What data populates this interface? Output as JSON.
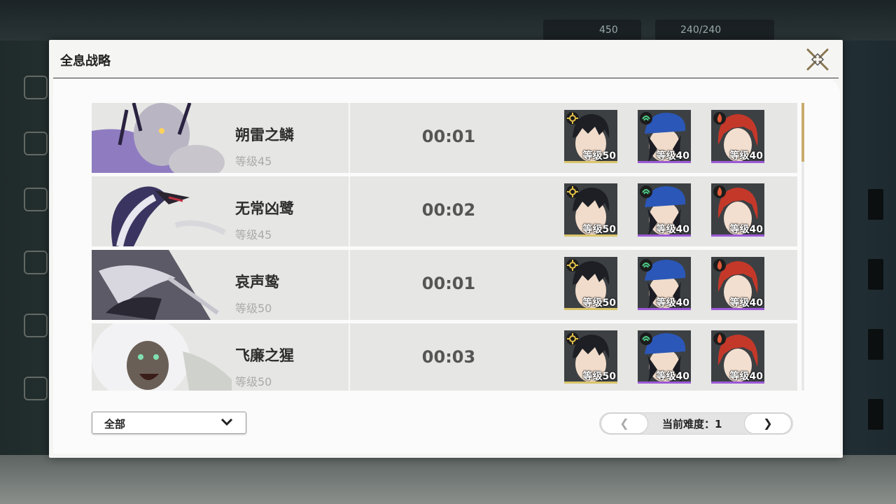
{
  "modal": {
    "title": "全息战略"
  },
  "hud": {
    "currency_value": "450",
    "stamina": "240/240"
  },
  "bosses": [
    {
      "name": "朔雷之鳞",
      "level": "等级45",
      "time": "00:01",
      "team": [
        {
          "level": "等级50",
          "element": "spectro",
          "bar_color": "#d9c56a"
        },
        {
          "level": "等级40",
          "element": "aero",
          "bar_color": "#9b59d6"
        },
        {
          "level": "等级40",
          "element": "fusion",
          "bar_color": "#9b59d6"
        }
      ]
    },
    {
      "name": "无常凶鹭",
      "level": "等级45",
      "time": "00:02",
      "team": [
        {
          "level": "等级50",
          "element": "spectro",
          "bar_color": "#d9c56a"
        },
        {
          "level": "等级40",
          "element": "aero",
          "bar_color": "#9b59d6"
        },
        {
          "level": "等级40",
          "element": "fusion",
          "bar_color": "#9b59d6"
        }
      ]
    },
    {
      "name": "哀声鸷",
      "level": "等级50",
      "time": "00:01",
      "team": [
        {
          "level": "等级50",
          "element": "spectro",
          "bar_color": "#d9c56a"
        },
        {
          "level": "等级40",
          "element": "aero",
          "bar_color": "#9b59d6"
        },
        {
          "level": "等级40",
          "element": "fusion",
          "bar_color": "#9b59d6"
        }
      ]
    },
    {
      "name": "飞廉之猩",
      "level": "等级50",
      "time": "00:03",
      "team": [
        {
          "level": "等级50",
          "element": "spectro",
          "bar_color": "#d9c56a"
        },
        {
          "level": "等级40",
          "element": "aero",
          "bar_color": "#9b59d6"
        },
        {
          "level": "等级40",
          "element": "fusion",
          "bar_color": "#9b59d6"
        }
      ]
    }
  ],
  "filter": {
    "selected": "全部"
  },
  "pager": {
    "label": "当前难度：",
    "value": "1",
    "prev": "❮",
    "next": "❯"
  },
  "colors": {
    "accent": "#c9ab6e",
    "element_spectro": "#e6c34a",
    "element_aero": "#4fcf8a",
    "element_fusion": "#e05a3a"
  }
}
